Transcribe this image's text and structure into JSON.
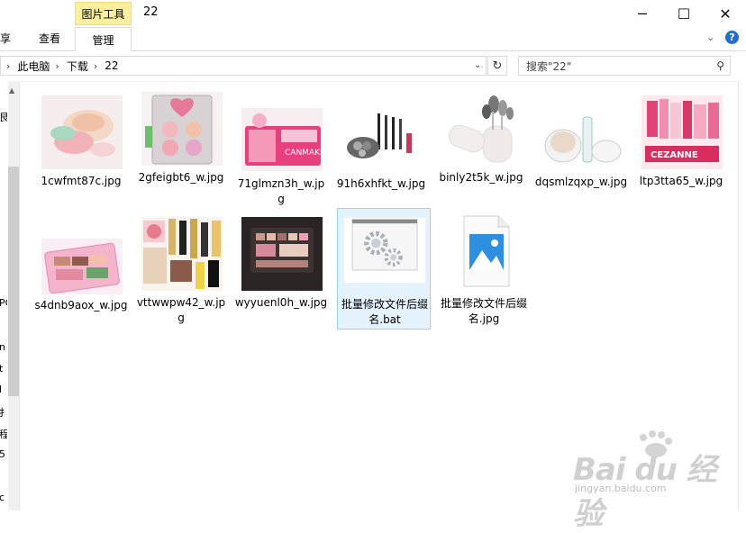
{
  "window": {
    "context_tab": "图片工具",
    "title": "22",
    "min_icon": "─",
    "max_icon": "☐",
    "close_icon": "✕"
  },
  "ribbon": {
    "tabs": [
      "享",
      "查看",
      "管理"
    ],
    "expand_icon": "⌄",
    "help_icon": "?"
  },
  "address": {
    "crumbs": [
      "此电脑",
      "下载",
      "22"
    ],
    "separator": "›",
    "dropdown_icon": "⌄",
    "refresh_icon": "↻"
  },
  "search": {
    "placeholder": "搜索\"22\"",
    "icon": "⚲"
  },
  "nav_fragments": [
    "艮",
    "PC",
    "n",
    "t",
    "l",
    "扌",
    "程",
    "5",
    "c"
  ],
  "files": [
    {
      "name": "1cwfmt87c.jpg",
      "thumb": "compact-powder-pastel"
    },
    {
      "name": "2gfeigbt6_w.jpg",
      "thumb": "heart-palette-box"
    },
    {
      "name": "71glmzn3h_w.jpg",
      "thumb": "canmake-pink-box"
    },
    {
      "name": "91h6xhfkt_w.jpg",
      "thumb": "eyeshadow-brushes-set"
    },
    {
      "name": "binly2t5k_w.jpg",
      "thumb": "brush-holder-white"
    },
    {
      "name": "dqsmlzqxp_w.jpg",
      "thumb": "cushion-compact"
    },
    {
      "name": "ltp3tta65_w.jpg",
      "thumb": "cezanne-products"
    },
    {
      "name": "s4dnb9aox_w.jpg",
      "thumb": "pink-palette-case"
    },
    {
      "name": "vttwwpw42_w.jpg",
      "thumb": "makeup-collection"
    },
    {
      "name": "wyyuenl0h_w.jpg",
      "thumb": "dark-palette-box"
    },
    {
      "name": "批量修改文件后缀名.bat",
      "thumb": "batch-gear-icon"
    },
    {
      "name": "批量修改文件后缀名.jpg",
      "thumb": "image-file-icon"
    }
  ],
  "watermark": {
    "main": "Bai du 经验",
    "sub": "jingyan.baidu.com"
  }
}
